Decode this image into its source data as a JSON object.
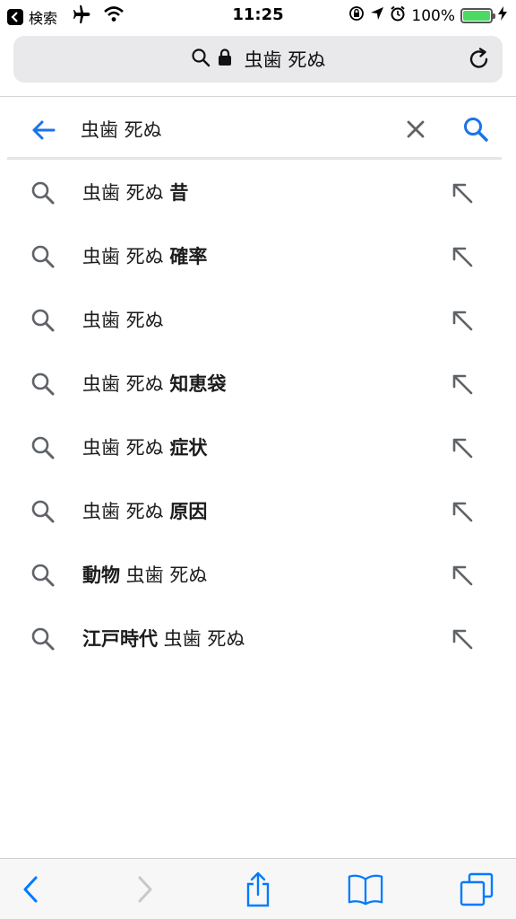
{
  "status_bar": {
    "back_label": "検索",
    "time": "11:25",
    "battery": "100%"
  },
  "address_bar": {
    "text": "虫歯 死ぬ"
  },
  "search": {
    "query": "虫歯 死ぬ"
  },
  "suggestions": [
    {
      "pre": "虫歯 死ぬ ",
      "bold": "昔",
      "post": ""
    },
    {
      "pre": "虫歯 死ぬ ",
      "bold": "確率",
      "post": ""
    },
    {
      "pre": "虫歯 死ぬ",
      "bold": "",
      "post": ""
    },
    {
      "pre": "虫歯 死ぬ ",
      "bold": "知恵袋",
      "post": ""
    },
    {
      "pre": "虫歯 死ぬ ",
      "bold": "症状",
      "post": ""
    },
    {
      "pre": "虫歯 死ぬ ",
      "bold": "原因",
      "post": ""
    },
    {
      "pre": "",
      "bold": "動物",
      "post": " 虫歯 死ぬ"
    },
    {
      "pre": "",
      "bold": "江戸時代",
      "post": " 虫歯 死ぬ"
    }
  ],
  "icons": {
    "airplane": "airplane-icon",
    "wifi": "wifi-icon",
    "lock": "lock-icon",
    "search": "search-icon",
    "reload": "reload-icon",
    "back": "arrow-left-icon",
    "clear": "close-icon",
    "fill": "arrow-up-left-icon",
    "share": "share-icon",
    "bookmarks": "book-icon",
    "tabs": "tabs-icon"
  },
  "colors": {
    "accent": "#1a73e8",
    "ios_blue": "#007aff",
    "battery": "#4cd964",
    "icon_gray": "#5f6368"
  }
}
